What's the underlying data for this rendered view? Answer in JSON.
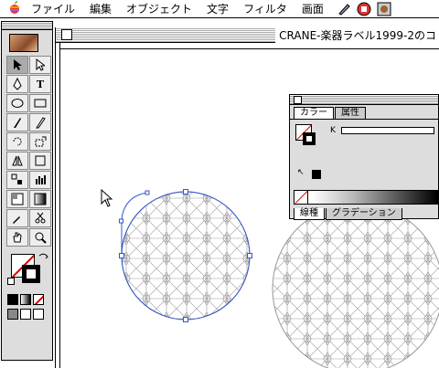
{
  "menubar": {
    "apple": "",
    "items": [
      "ファイル",
      "編集",
      "オブジェクト",
      "文字",
      "フィルタ",
      "画面"
    ]
  },
  "document": {
    "title": "CRANE-楽器ラベル1999-2のコ"
  },
  "toolbox": {
    "type_tool": "T",
    "text_tool_label": "T"
  },
  "palette": {
    "tabs": [
      "カラー",
      "属性"
    ],
    "channel_label": "K",
    "bottom_tabs": [
      "線種",
      "グラデーション"
    ]
  },
  "colors": {
    "none_slash": "#dd0000",
    "selection": "#3355cc"
  }
}
